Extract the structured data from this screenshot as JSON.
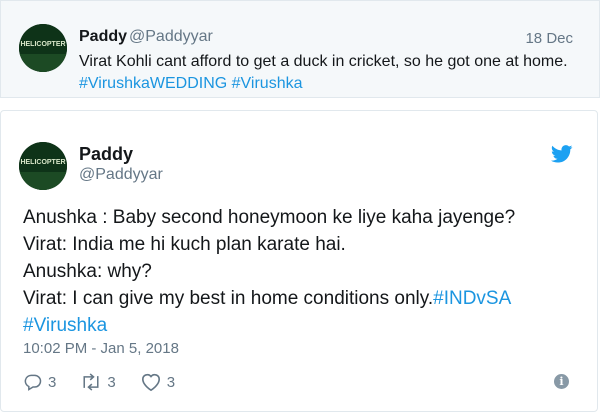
{
  "quoted": {
    "name": "Paddy",
    "handle": "@Paddyyar",
    "date": "18 Dec",
    "text_plain": "Virat Kohli cant afford to get a duck in cricket, so he got one at home. ",
    "hashtag1": "#VirushkaWEDDING",
    "hashtag2": "#Virushka",
    "avatar_text": "HELICOPTER"
  },
  "tweet": {
    "name": "Paddy",
    "handle": "@Paddyyar",
    "avatar_text": "HELICOPTER",
    "line1": "Anushka : Baby second honeymoon ke liye kaha jayenge?",
    "line2": "Virat: India me hi kuch plan karate hai.",
    "line3": "Anushka: why?",
    "line4_plain": "Virat: I can give my best in home conditions only.",
    "line4_hashtag": "#INDvSA",
    "line5_hashtag": "#Virushka",
    "timestamp": "10:02 PM - Jan 5, 2018",
    "reply_count": "3",
    "retweet_count": "3",
    "like_count": "3"
  },
  "colors": {
    "hashtag": "#1b95e0",
    "muted": "#657786",
    "twitter_blue": "#1da1f2"
  },
  "icons": {
    "reply": "reply-icon",
    "retweet": "retweet-icon",
    "like": "heart-icon",
    "info": "info-icon",
    "brand": "twitter-bird-icon"
  }
}
